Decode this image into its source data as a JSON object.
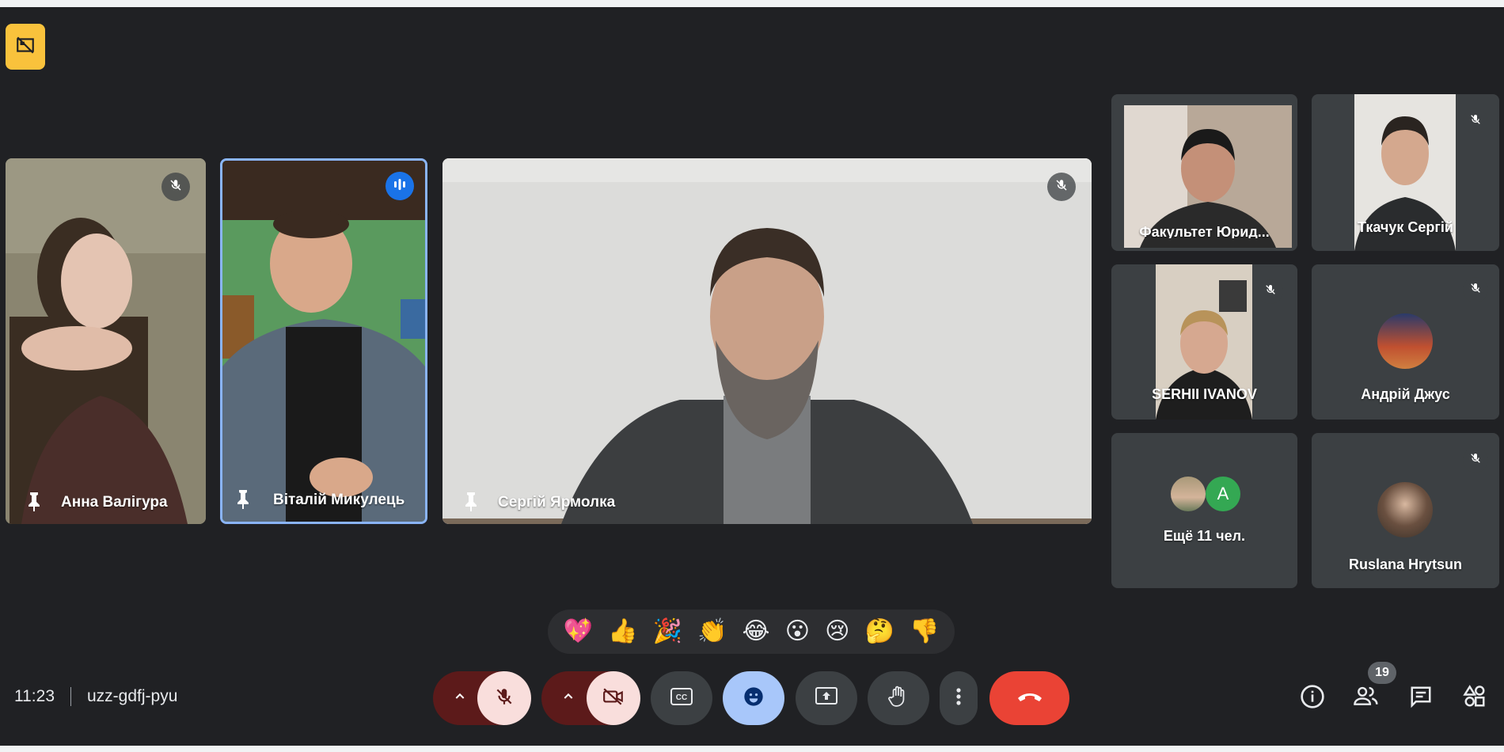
{
  "meeting": {
    "time": "11:23",
    "code": "uzz-gdfj-pyu"
  },
  "main_tiles": [
    {
      "name": "Анна Валігура"
    },
    {
      "name": "Віталій Микулець"
    },
    {
      "name": "Сергій Ярмолка"
    }
  ],
  "side_tiles": [
    {
      "name": "Факультет Юрид..."
    },
    {
      "name": "Ткачук Сергій"
    },
    {
      "name": "SERHII IVANOV"
    },
    {
      "name": "Андрій Джус"
    },
    {
      "name": "Ещё 11 чел.",
      "avatar_letter": "A"
    },
    {
      "name": "Ruslana Hrytsun"
    }
  ],
  "reactions": [
    "💖",
    "👍",
    "🎉",
    "👏",
    "😂",
    "😮",
    "😢",
    "🤔",
    "👎"
  ],
  "people_count": "19",
  "icons": {
    "top_badge": "no-video-tile-icon",
    "pin": "pin-icon",
    "mic_off": "mic-off-icon",
    "speaking": "speaking-indicator-icon",
    "controls": [
      "chevron-up-icon",
      "mic-off-icon",
      "chevron-up-icon",
      "camera-off-icon",
      "captions-icon",
      "emoji-icon",
      "present-icon",
      "raise-hand-icon",
      "more-icon",
      "end-call-icon"
    ],
    "right": [
      "info-icon",
      "people-icon",
      "chat-icon",
      "activities-icon"
    ]
  },
  "colors": {
    "background": "#202124",
    "tile": "#3c4043",
    "accent_blue": "#8ab4f8",
    "end_call": "#ea4335",
    "control_dark_red": "#5c1a1a",
    "control_light_red": "#f9dedc",
    "badge_yellow": "#f9c23c"
  }
}
